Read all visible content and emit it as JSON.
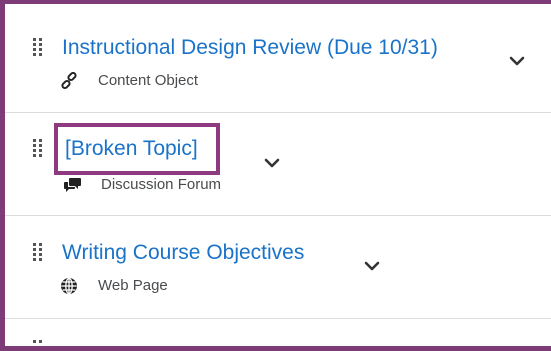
{
  "items": [
    {
      "title": "Instructional Design Review (Due 10/31)",
      "type": "Content Object",
      "icon": "link-icon"
    },
    {
      "title": "[Broken Topic]",
      "type": "Discussion Forum",
      "icon": "discussion-icon"
    },
    {
      "title": "Writing Course Objectives",
      "type": "Web Page",
      "icon": "globe-icon"
    }
  ],
  "colors": {
    "link": "#1a73c9",
    "frame": "#7d3c77",
    "highlight": "#8e3a80",
    "subtext": "#494c4e"
  }
}
